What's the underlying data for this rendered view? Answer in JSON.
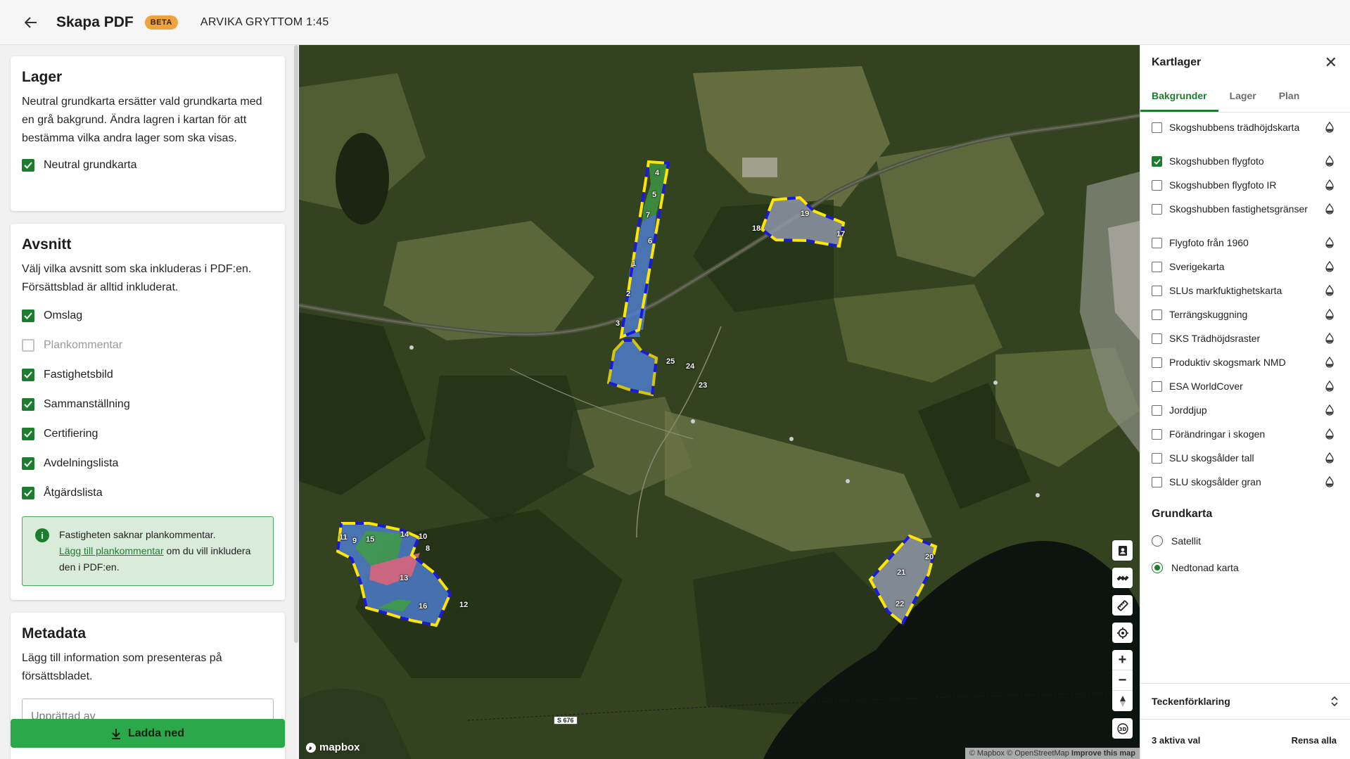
{
  "header": {
    "app_title": "Skapa PDF",
    "beta_label": "BETA",
    "map_title": "ARVIKA GRYTTOM 1:45"
  },
  "lager": {
    "title": "Lager",
    "description": "Neutral grundkarta ersätter vald grundkarta med en grå bakgrund. Ändra lagren i kartan för att bestämma vilka andra lager som ska visas.",
    "neutral_label": "Neutral grundkarta"
  },
  "avsnitt": {
    "title": "Avsnitt",
    "description": "Välj vilka avsnitt som ska inkluderas i PDF:en. Försättsblad är alltid inkluderat.",
    "items": [
      {
        "label": "Omslag",
        "state": "checked"
      },
      {
        "label": "Plankommentar",
        "state": "disabled"
      },
      {
        "label": "Fastighetsbild",
        "state": "checked"
      },
      {
        "label": "Sammanställning",
        "state": "checked"
      },
      {
        "label": "Certifiering",
        "state": "checked"
      },
      {
        "label": "Avdelningslista",
        "state": "checked"
      },
      {
        "label": "Åtgärdslista",
        "state": "checked"
      }
    ],
    "info_text_1": "Fastigheten saknar plankommentar.",
    "info_link": "Lägg till plankommentar",
    "info_text_2": " om du vill inkludera den i PDF:en."
  },
  "metadata": {
    "title": "Metadata",
    "description": "Lägg till information som presenteras på försättsbladet.",
    "field_placeholder": "Upprättad av"
  },
  "download_label": "Ladda ned",
  "map": {
    "road_label": "S 676",
    "mapbox_label": "mapbox",
    "attribution": "© Mapbox © OpenStreetMap",
    "improve_label": "Improve this map",
    "stand_labels": [
      "1",
      "2",
      "3",
      "4",
      "5",
      "6",
      "7",
      "8",
      "9",
      "10",
      "11",
      "12",
      "13",
      "14",
      "15",
      "16",
      "17",
      "18",
      "19",
      "20",
      "21",
      "22",
      "23",
      "24",
      "25"
    ]
  },
  "kartlager": {
    "title": "Kartlager",
    "tabs": [
      "Bakgrunder",
      "Lager",
      "Plan"
    ],
    "active_tab": "Bakgrunder",
    "layers": [
      {
        "label": "Skogshubbens trädhöjdskarta",
        "checked": false
      },
      {
        "label": "Skogshubben flygfoto",
        "checked": true
      },
      {
        "label": "Skogshubben flygfoto IR",
        "checked": false
      },
      {
        "label": "Skogshubben fastighetsgränser",
        "checked": false
      },
      {
        "label": "Flygfoto från 1960",
        "checked": false
      },
      {
        "label": "Sverigekarta",
        "checked": false
      },
      {
        "label": "SLUs markfuktighetskarta",
        "checked": false
      },
      {
        "label": "Terrängskuggning",
        "checked": false
      },
      {
        "label": "SKS Trädhöjdsraster",
        "checked": false
      },
      {
        "label": "Produktiv skogsmark NMD",
        "checked": false
      },
      {
        "label": "ESA WorldCover",
        "checked": false
      },
      {
        "label": "Jorddjup",
        "checked": false
      },
      {
        "label": "Förändringar i skogen",
        "checked": false
      },
      {
        "label": "SLU skogsålder tall",
        "checked": false
      },
      {
        "label": "SLU skogsålder gran",
        "checked": false
      }
    ],
    "grundkarta_title": "Grundkarta",
    "grundkarta_options": [
      {
        "label": "Satellit",
        "selected": false
      },
      {
        "label": "Nedtonad karta",
        "selected": true
      }
    ],
    "legend_label": "Teckenförklaring",
    "active_count": "3 aktiva val",
    "clear_label": "Rensa alla"
  },
  "colors": {
    "accent": "#1d7d2f",
    "beta": "#f0a33c",
    "download": "#2aa84a",
    "stand_blue": "#4f7fd6",
    "stand_green": "#3f9b45",
    "stand_red": "#d9657c",
    "boundary_yellow": "#ffe600",
    "boundary_blue": "#1a1adb"
  }
}
